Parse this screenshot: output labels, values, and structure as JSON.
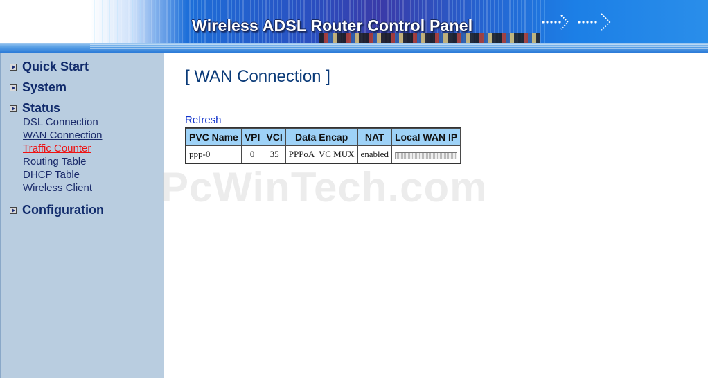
{
  "banner": {
    "title": "Wireless ADSL Router Control Panel"
  },
  "sidebar": {
    "sections": [
      {
        "label": "Quick Start"
      },
      {
        "label": "System"
      },
      {
        "label": "Status"
      },
      {
        "label": "Configuration"
      }
    ],
    "status_items": [
      {
        "label": "DSL Connection",
        "linked": false
      },
      {
        "label": "WAN Connection",
        "linked": true
      },
      {
        "label": "Traffic Counter",
        "linked": true,
        "active": true
      },
      {
        "label": "Routing Table",
        "linked": false
      },
      {
        "label": "DHCP Table",
        "linked": false
      },
      {
        "label": "Wireless Client",
        "linked": false
      }
    ]
  },
  "main": {
    "title": "[ WAN Connection ]",
    "refresh_label": "Refresh",
    "table": {
      "headers": [
        "PVC Name",
        "VPI",
        "VCI",
        "Data Encap",
        "NAT",
        "Local WAN IP"
      ],
      "rows": [
        {
          "pvc_name": "ppp-0",
          "vpi": "0",
          "vci": "35",
          "data_encap": "PPPoA  VC MUX",
          "nat": "enabled",
          "local_wan_ip": ""
        }
      ]
    }
  },
  "watermark": "PcWinTech.com",
  "colors": {
    "sidebar_bg": "#b9cde0",
    "table_header_bg": "#9ed2f7",
    "title_color": "#0a3a78",
    "active_link": "#ee1111",
    "rule_color": "#e3a35a"
  }
}
